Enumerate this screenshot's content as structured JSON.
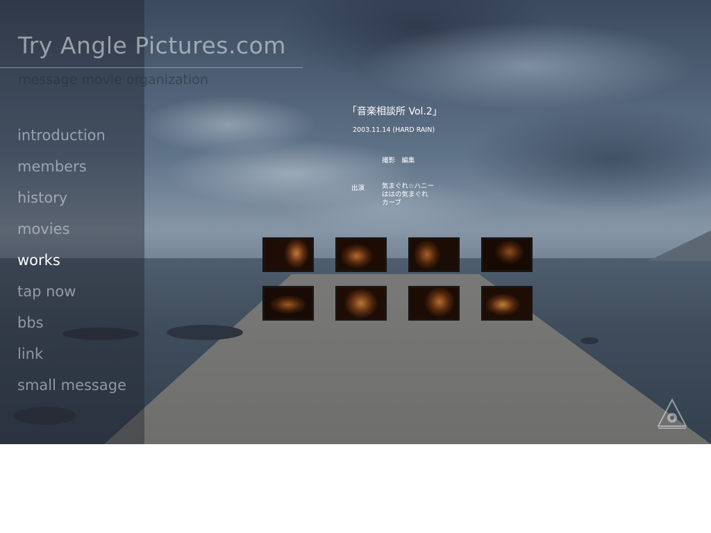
{
  "site": {
    "title": "Try Angle Pictures.com",
    "tagline": "message movie organization"
  },
  "nav": [
    {
      "label": "introduction",
      "active": false
    },
    {
      "label": "members",
      "active": false
    },
    {
      "label": "history",
      "active": false
    },
    {
      "label": "movies",
      "active": false
    },
    {
      "label": "works",
      "active": true
    },
    {
      "label": "tap now",
      "active": false
    },
    {
      "label": "bbs",
      "active": false
    },
    {
      "label": "link",
      "active": false
    },
    {
      "label": "small message",
      "active": false
    }
  ],
  "work": {
    "title": "「音楽相談所 Vol.2」",
    "date": "2003.11.14 (HARD RAIN)",
    "credit": "撮影　編集",
    "cast_label": "出演",
    "cast": [
      "気まぐれ☆ハニー",
      "ははの気まぐれ",
      "カーブ"
    ]
  },
  "thumbnails": [
    {
      "name": "live-photo-1"
    },
    {
      "name": "live-photo-2"
    },
    {
      "name": "live-photo-3"
    },
    {
      "name": "live-photo-4"
    },
    {
      "name": "live-photo-5"
    },
    {
      "name": "live-photo-6"
    },
    {
      "name": "live-photo-7"
    },
    {
      "name": "live-photo-8"
    }
  ],
  "colors": {
    "nav_text": "#e1e6ec",
    "nav_active": "#ffffff",
    "detail_text": "#ffffff",
    "thumb_tone": "#7a3c14"
  },
  "icons": {
    "logo": "triangle-eye-logo-icon"
  }
}
